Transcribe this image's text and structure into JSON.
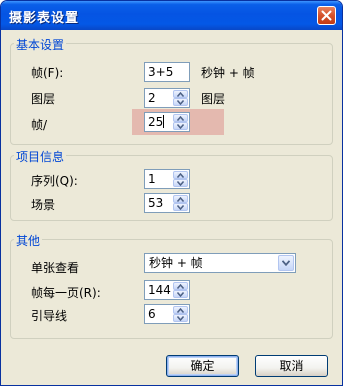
{
  "window": {
    "title": "摄影表设置"
  },
  "basic": {
    "group_title": "基本设置",
    "frame_label": "帧(F):",
    "frame_value": "3+5",
    "frame_unit": "秒钟 + 帧",
    "layer_label": "图层",
    "layer_value": "2",
    "layer_unit": "图层",
    "fps_label": "帧/",
    "fps_value": "25"
  },
  "project": {
    "group_title": "项目信息",
    "sequence_label": "序列(Q):",
    "sequence_value": "1",
    "scene_label": "场景",
    "scene_value": "53"
  },
  "other": {
    "group_title": "其他",
    "single_view_label": "单张查看",
    "single_view_value": "秒钟 + 帧",
    "frames_per_page_label": "帧每一页(R):",
    "frames_per_page_value": "144",
    "guides_label": "引导线",
    "guides_value": "6"
  },
  "buttons": {
    "ok": "确定",
    "cancel": "取消"
  }
}
